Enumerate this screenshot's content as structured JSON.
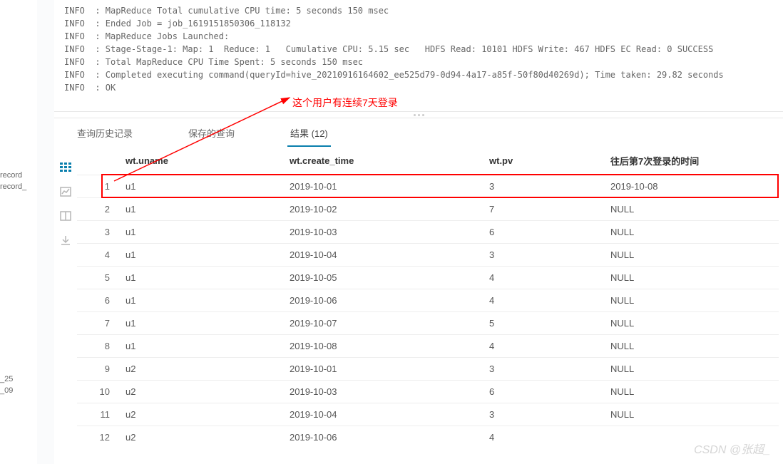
{
  "left_sidebar_fragments": [
    "record",
    "record_",
    "_25",
    "_09"
  ],
  "log_lines": [
    "INFO  : MapReduce Total cumulative CPU time: 5 seconds 150 msec",
    "INFO  : Ended Job = job_1619151850306_118132",
    "INFO  : MapReduce Jobs Launched:",
    "INFO  : Stage-Stage-1: Map: 1  Reduce: 1   Cumulative CPU: 5.15 sec   HDFS Read: 10101 HDFS Write: 467 HDFS EC Read: 0 SUCCESS",
    "INFO  : Total MapReduce CPU Time Spent: 5 seconds 150 msec",
    "INFO  : Completed executing command(queryId=hive_20210916164602_ee525d79-0d94-4a17-a85f-50f80d40269d); Time taken: 29.82 seconds",
    "INFO  : OK"
  ],
  "annotation": "这个用户有连续7天登录",
  "tabs": {
    "history": "查询历史记录",
    "saved": "保存的查询",
    "results": "结果 (12)"
  },
  "columns": {
    "uname": "wt.uname",
    "ctime": "wt.create_time",
    "pv": "wt.pv",
    "seventh": "往后第7次登录的时间"
  },
  "rows": [
    {
      "n": "1",
      "uname": "u1",
      "ctime": "2019-10-01",
      "pv": "3",
      "seventh": "2019-10-08"
    },
    {
      "n": "2",
      "uname": "u1",
      "ctime": "2019-10-02",
      "pv": "7",
      "seventh": "NULL"
    },
    {
      "n": "3",
      "uname": "u1",
      "ctime": "2019-10-03",
      "pv": "6",
      "seventh": "NULL"
    },
    {
      "n": "4",
      "uname": "u1",
      "ctime": "2019-10-04",
      "pv": "3",
      "seventh": "NULL"
    },
    {
      "n": "5",
      "uname": "u1",
      "ctime": "2019-10-05",
      "pv": "4",
      "seventh": "NULL"
    },
    {
      "n": "6",
      "uname": "u1",
      "ctime": "2019-10-06",
      "pv": "4",
      "seventh": "NULL"
    },
    {
      "n": "7",
      "uname": "u1",
      "ctime": "2019-10-07",
      "pv": "5",
      "seventh": "NULL"
    },
    {
      "n": "8",
      "uname": "u1",
      "ctime": "2019-10-08",
      "pv": "4",
      "seventh": "NULL"
    },
    {
      "n": "9",
      "uname": "u2",
      "ctime": "2019-10-01",
      "pv": "3",
      "seventh": "NULL"
    },
    {
      "n": "10",
      "uname": "u2",
      "ctime": "2019-10-03",
      "pv": "6",
      "seventh": "NULL"
    },
    {
      "n": "11",
      "uname": "u2",
      "ctime": "2019-10-04",
      "pv": "3",
      "seventh": "NULL"
    },
    {
      "n": "12",
      "uname": "u2",
      "ctime": "2019-10-06",
      "pv": "4",
      "seventh": ""
    }
  ],
  "watermark": "CSDN @张超_"
}
